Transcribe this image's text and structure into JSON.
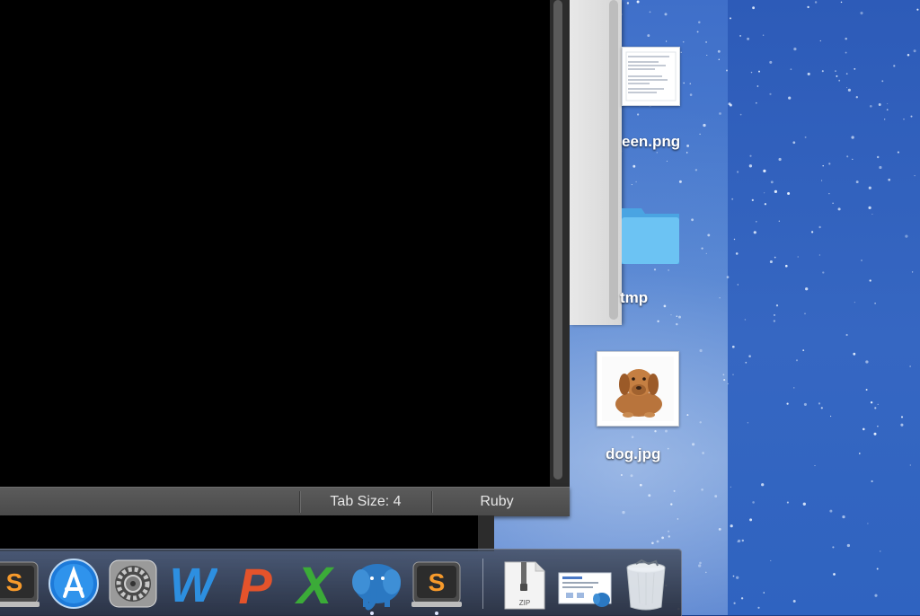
{
  "editor": {
    "status_tab_size": "Tab Size: 4",
    "status_syntax": "Ruby"
  },
  "desktop_icons": [
    {
      "label": "een.png",
      "icon": "image-file-icon"
    },
    {
      "label": "tmp",
      "icon": "folder-icon"
    },
    {
      "label": "dog.jpg",
      "icon": "image-file-icon"
    }
  ],
  "dock": {
    "apps": [
      {
        "name": "sublime-text",
        "icon": "sublime-text-icon",
        "letter": "S"
      },
      {
        "name": "app-store",
        "icon": "app-store-icon"
      },
      {
        "name": "system-preferences",
        "icon": "gear-icon"
      },
      {
        "name": "word",
        "icon": "word-icon",
        "letter": "W"
      },
      {
        "name": "powerpoint",
        "icon": "powerpoint-icon",
        "letter": "P"
      },
      {
        "name": "excel",
        "icon": "excel-icon",
        "letter": "X"
      },
      {
        "name": "postgres",
        "icon": "elephant-icon"
      },
      {
        "name": "sublime-text-2",
        "icon": "sublime-text-icon",
        "letter": "S"
      }
    ],
    "stack_zip_label": "ZIP"
  },
  "colors": {
    "folder": "#5cb6ee",
    "word": "#2d8fe0",
    "powerpoint": "#e4532b",
    "excel": "#3bab38",
    "sublime": "#f79a2b"
  }
}
